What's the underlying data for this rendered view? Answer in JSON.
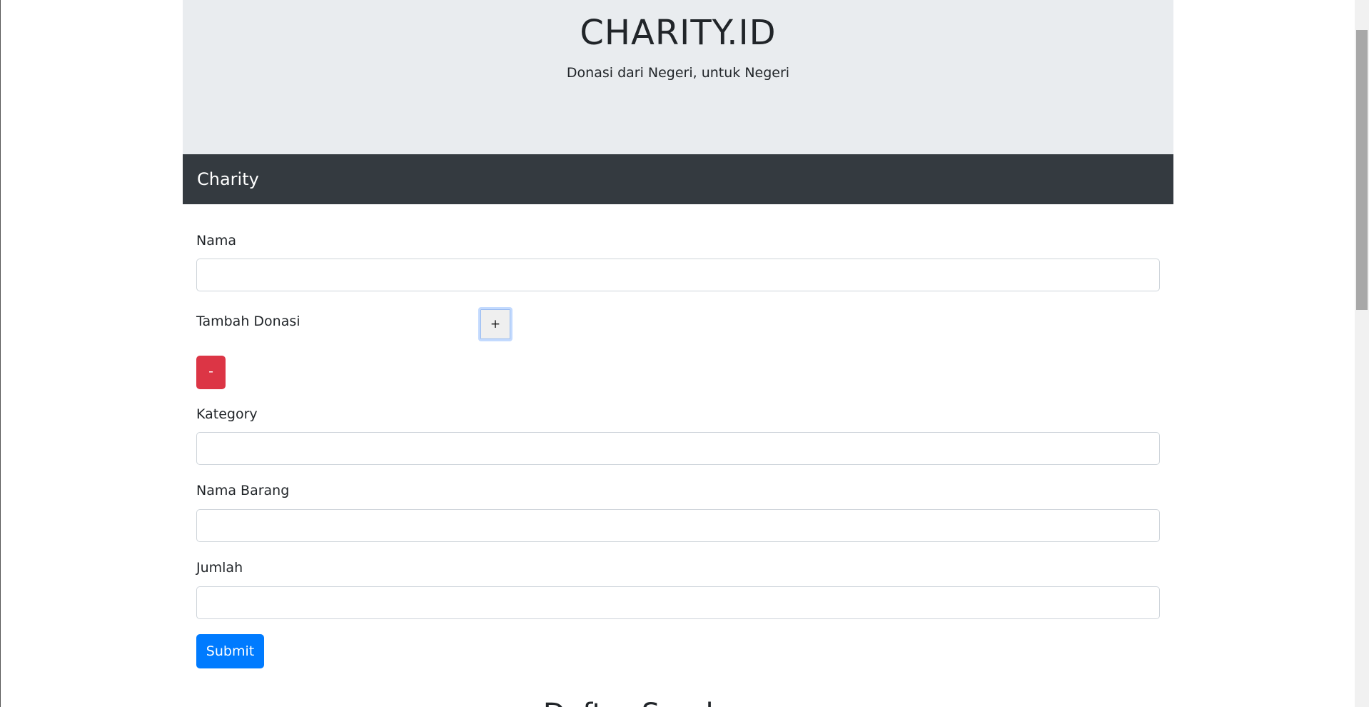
{
  "header": {
    "title": "CHARITY.ID",
    "tagline": "Donasi dari Negeri, untuk Negeri"
  },
  "navbar": {
    "brand": "Charity"
  },
  "form": {
    "nama_label": "Nama",
    "nama_value": "",
    "tambah_donasi_label": "Tambah Donasi",
    "add_button_label": "+",
    "remove_button_label": "-",
    "kategory_label": "Kategory",
    "kategory_value": "",
    "nama_barang_label": "Nama Barang",
    "nama_barang_value": "",
    "jumlah_label": "Jumlah",
    "jumlah_value": "",
    "submit_label": "Submit"
  },
  "list_section": {
    "heading": "Daftar Sumbangan"
  },
  "colors": {
    "jumbotron_bg": "#e9ecef",
    "navbar_bg": "#343a40",
    "danger": "#dc3545",
    "primary": "#007bff"
  }
}
